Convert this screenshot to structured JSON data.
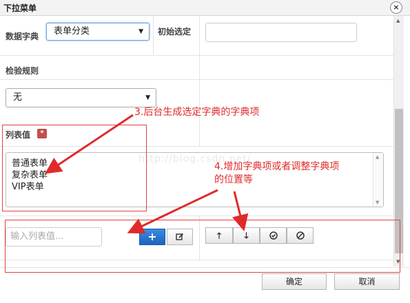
{
  "window": {
    "title": "下拉菜单",
    "close_label": "×"
  },
  "form": {
    "dict_label": "数据字典",
    "dict_select_value": "表单分类",
    "init_label": "初始选定",
    "validation_label": "检验规则",
    "validation_select_value": "无",
    "list_values_label": "列表值",
    "required_mark": "*",
    "list_items": [
      "普通表单",
      "复杂表单",
      "VIP表单"
    ],
    "input_placeholder": "输入列表值..."
  },
  "buttons": {
    "ok": "确定",
    "cancel": "取消"
  },
  "icons": {
    "add": "plus-icon",
    "edit": "edit-icon",
    "move_up": "arrow-up-icon",
    "move_down": "arrow-down-icon",
    "check": "check-circle-icon",
    "block": "ban-icon"
  },
  "annotations": {
    "note3": "3.后台生成选定字典的字典项",
    "note4_line1": "4.增加字典项或者调整字典项",
    "note4_line2": "的位置等",
    "watermark": "http://blog.csdn.net/"
  },
  "colors": {
    "annotation": "#e02a2a",
    "primary_button": "#1d64bd"
  }
}
